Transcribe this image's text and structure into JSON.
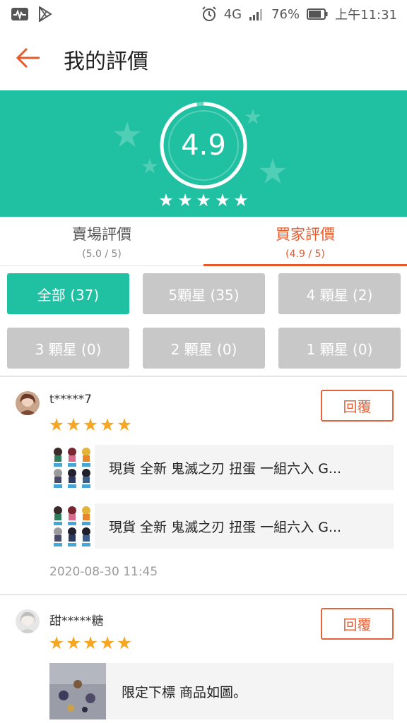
{
  "status_bar": {
    "battery": "76%",
    "time": "上午11:31",
    "network": "4G",
    "icons": [
      "activity-icon",
      "play-store-icon",
      "alarm-icon",
      "network-4g-icon",
      "signal-icon",
      "battery-icon"
    ]
  },
  "toolbar": {
    "back_icon": "arrow-left-icon",
    "title": "我的評價"
  },
  "banner": {
    "score": "4.9",
    "stars": 5,
    "accent": "#20c0a2"
  },
  "tabs": [
    {
      "label": "賣場評價",
      "sub": "(5.0 / 5)",
      "active": false
    },
    {
      "label": "買家評價",
      "sub": "(4.9 / 5)",
      "active": true
    }
  ],
  "filters": [
    {
      "label": "全部 (37)",
      "active": true
    },
    {
      "label": "5顆星 (35)",
      "active": false
    },
    {
      "label": "4 顆星 (2)",
      "active": false
    },
    {
      "label": "3 顆星 (0)",
      "active": false
    },
    {
      "label": "2 顆星 (0)",
      "active": false
    },
    {
      "label": "1 顆星 (0)",
      "active": false
    }
  ],
  "reviews": [
    {
      "username": "t*****7",
      "reply_label": "回覆",
      "stars": 5,
      "products": [
        {
          "name": "現貨 全新 鬼滅之刃  扭蛋 一組六入 G..."
        },
        {
          "name": "現貨 全新 鬼滅之刃  扭蛋 一組六入 G..."
        }
      ],
      "date": "2020-08-30 11:45"
    },
    {
      "username": "甜*****糖",
      "reply_label": "回覆",
      "stars": 5,
      "comment": "限定下標 商品如圖。"
    }
  ],
  "colors": {
    "accent": "#20c0a2",
    "orange": "#e65a2c",
    "star": "#f5a623",
    "filter_inactive": "#c8c8c8"
  }
}
